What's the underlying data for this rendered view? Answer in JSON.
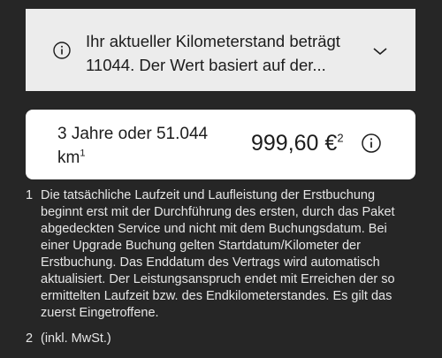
{
  "info_banner": {
    "text": "Ihr aktueller Kilometerstand beträgt 11044. Der Wert basiert auf der...",
    "icon": "info-circle-icon",
    "toggle_icon": "chevron-down-icon"
  },
  "price_card": {
    "duration_text": "3 Jahre oder 51.044 km",
    "duration_footnote": "1",
    "price": "999,60 €",
    "price_footnote": "2",
    "info_icon": "info-circle-icon"
  },
  "footnotes": [
    {
      "number": "1",
      "text": "Die tatsächliche Laufzeit und Laufleistung der Erstbuchung beginnt erst mit der Durchführung des ersten, durch das Paket abgedeckten Service und nicht mit dem Buchungsdatum. Bei einer Upgrade Buchung gelten Startdatum/Kilometer der Erstbuchung. Das Enddatum des Vertrags wird automatisch aktualisiert. Der Leistungsanspruch endet mit Erreichen der so ermittelten Laufzeit bzw. des Endkilometerstandes. Es gilt das zuerst Eingetroffene."
    },
    {
      "number": "2",
      "text": "(inkl. MwSt.)"
    }
  ],
  "colors": {
    "background": "#262626",
    "banner_bg": "#ececec",
    "card_bg": "#ffffff",
    "text_dark": "#1c1c1c",
    "text_light": "#e6e6e6"
  }
}
